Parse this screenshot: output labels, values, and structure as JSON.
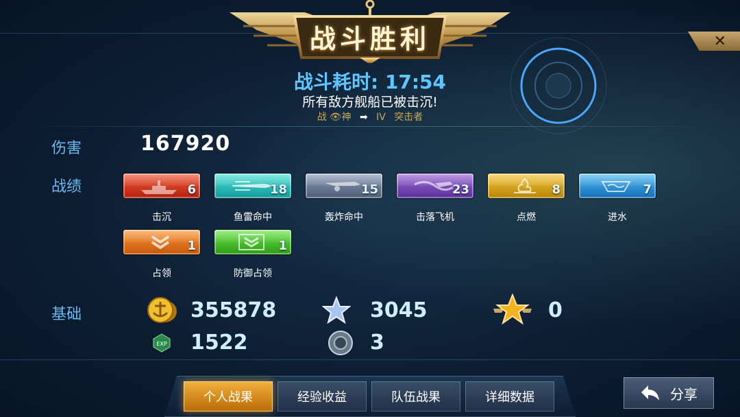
{
  "header": {
    "title": "战斗胜利",
    "battle_time": "战斗耗时: 17:54",
    "result_message": "所有敌方舰船已被击沉!",
    "rank_from": "战",
    "rank_from2": "神",
    "rank_to_tier": "IV",
    "rank_to_name": "突击者",
    "close_label": "✕"
  },
  "damage": {
    "label": "伤害",
    "value": "167920"
  },
  "achievements": {
    "label": "战绩",
    "items": [
      {
        "label": "击沉",
        "count": "6",
        "icon": "ship-sunk-icon",
        "color": "#d83a1e"
      },
      {
        "label": "鱼雷命中",
        "count": "18",
        "icon": "torpedo-icon",
        "color": "#22b8b6"
      },
      {
        "label": "轰炸命中",
        "count": "15",
        "icon": "bomber-icon",
        "color": "#6d7d98"
      },
      {
        "label": "击落飞机",
        "count": "23",
        "icon": "plane-shot-icon",
        "color": "#7a4ab8"
      },
      {
        "label": "点燃",
        "count": "8",
        "icon": "fire-icon",
        "color": "#d9a11e"
      },
      {
        "label": "进水",
        "count": "7",
        "icon": "flooding-icon",
        "color": "#2b93d8"
      },
      {
        "label": "占领",
        "count": "1",
        "icon": "capture-icon",
        "color": "#e1761e"
      },
      {
        "label": "防御占领",
        "count": "1",
        "icon": "defend-capture-icon",
        "color": "#46c02a"
      }
    ]
  },
  "basics": {
    "label": "基础",
    "silver": "355878",
    "star_points": "3045",
    "gold_star": "0",
    "exp": "1522",
    "gear": "3",
    "exp_badge": "EXP"
  },
  "tabs": [
    {
      "label": "个人战果",
      "active": true
    },
    {
      "label": "经验收益",
      "active": false
    },
    {
      "label": "队伍战果",
      "active": false
    },
    {
      "label": "详细数据",
      "active": false
    }
  ],
  "share": {
    "label": "分享",
    "icon": "back-arrow-icon"
  }
}
